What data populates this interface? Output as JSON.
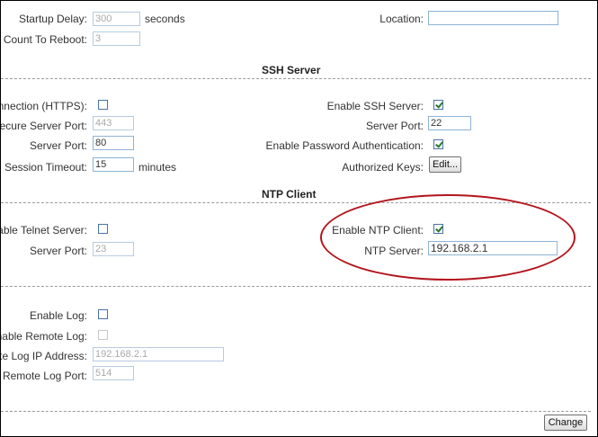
{
  "general": {
    "startup_delay_label": "Startup Delay:",
    "startup_delay_value": "300",
    "startup_delay_unit": "seconds",
    "location_label": "Location:",
    "location_value": "",
    "failure_count_label": "ure Count To Reboot:",
    "failure_count_value": "3"
  },
  "ssh_section": {
    "title": "SSH Server"
  },
  "https": {
    "connection_label": "Connection (HTTPS):",
    "connection_checked": false,
    "secure_port_label": "Secure Server Port:",
    "secure_port_value": "443",
    "server_port_label": "Server Port:",
    "server_port_value": "80",
    "session_timeout_label": "Session Timeout:",
    "session_timeout_value": "15",
    "session_timeout_unit": "minutes"
  },
  "ssh": {
    "enable_label": "Enable SSH Server:",
    "enable_checked": true,
    "port_label": "Server Port:",
    "port_value": "22",
    "password_auth_label": "Enable Password Authentication:",
    "password_auth_checked": true,
    "authorized_keys_label": "Authorized Keys:",
    "edit_button": "Edit..."
  },
  "ntp_section": {
    "title": "NTP Client"
  },
  "telnet": {
    "enable_label": "Enable Telnet Server:",
    "enable_checked": false,
    "port_label": "Server Port:",
    "port_value": "23"
  },
  "ntp": {
    "enable_label": "Enable NTP Client:",
    "enable_checked": true,
    "server_label": "NTP Server:",
    "server_value": "192.168.2.1"
  },
  "log": {
    "enable_label": "Enable Log:",
    "enable_checked": false,
    "remote_label": "Enable Remote Log:",
    "remote_checked": false,
    "remote_ip_label": "mote Log IP Address:",
    "remote_ip_value": "192.168.2.1",
    "remote_port_label": "Remote Log Port:",
    "remote_port_value": "514"
  },
  "footer": {
    "change_button": "Change"
  },
  "colors": {
    "annotation": "#b3141c",
    "field_border": "#8eb3d6",
    "check": "#2c7a2c"
  }
}
